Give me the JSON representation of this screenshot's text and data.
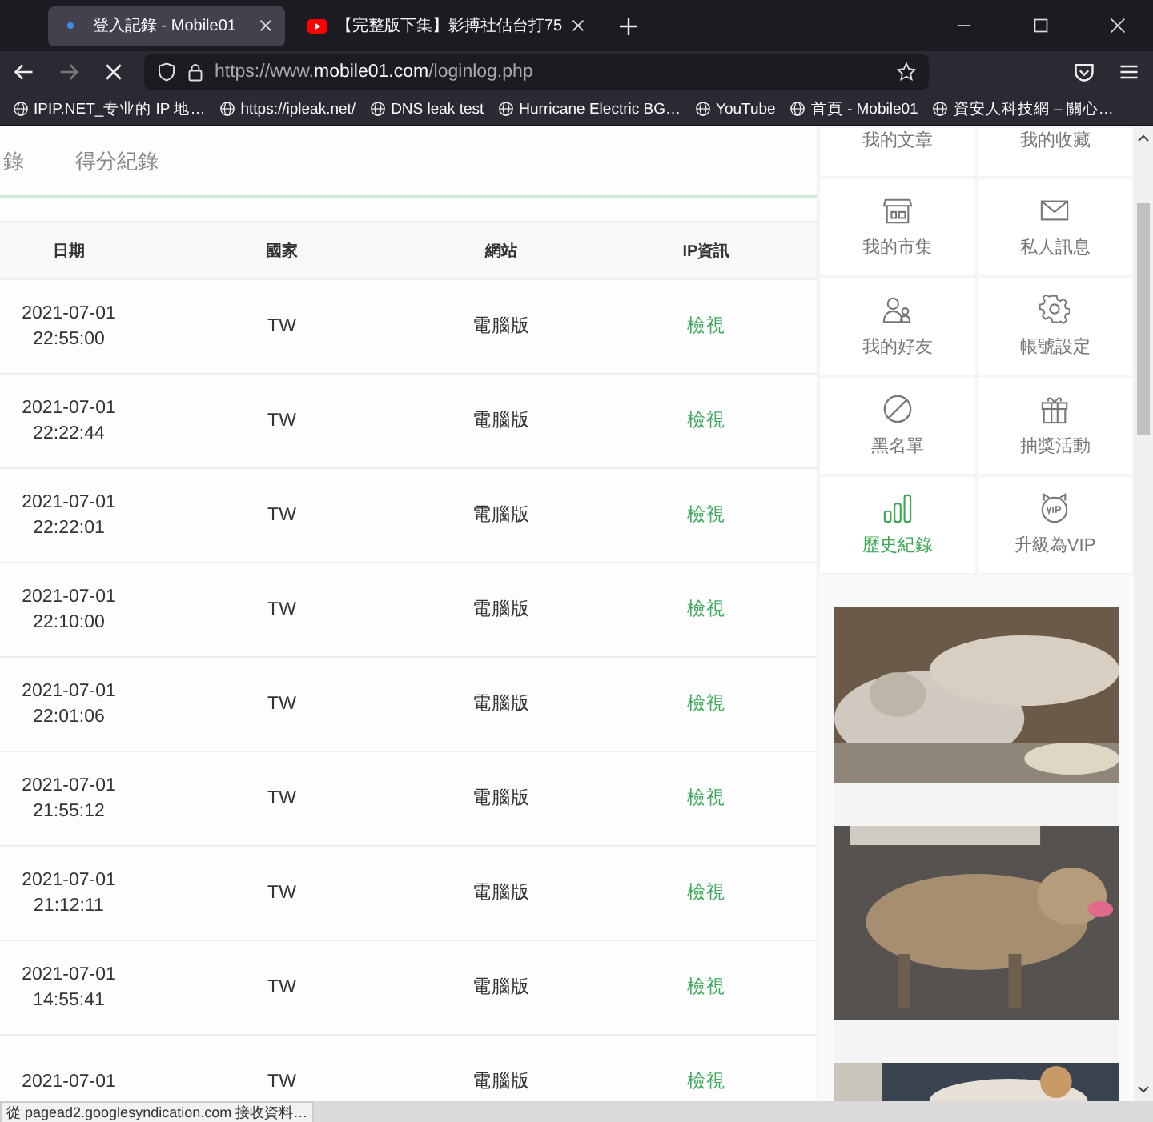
{
  "browser_tabs": [
    {
      "title": "登入記錄 - Mobile01",
      "selected": true
    },
    {
      "title": "【完整版下集】影搏社估台打75",
      "selected": false
    }
  ],
  "address_bar": {
    "prefix": "https://www.",
    "domain": "mobile01.com",
    "path": "/loginlog.php"
  },
  "bookmarks": [
    "IPIP.NET_专业的 IP 地…",
    "https://ipleak.net/",
    "DNS leak test",
    "Hurricane Electric BG…",
    "YouTube",
    "首頁 - Mobile01",
    "資安人科技網 – 關心…"
  ],
  "page_tabs": [
    "錄",
    "得分紀錄"
  ],
  "table": {
    "columns": [
      "日期",
      "國家",
      "網站",
      "IP資訊"
    ],
    "rows": [
      {
        "date": "2021-07-01",
        "time": "22:55:00",
        "country": "TW",
        "site": "電腦版",
        "ip": "檢視"
      },
      {
        "date": "2021-07-01",
        "time": "22:22:44",
        "country": "TW",
        "site": "電腦版",
        "ip": "檢視"
      },
      {
        "date": "2021-07-01",
        "time": "22:22:01",
        "country": "TW",
        "site": "電腦版",
        "ip": "檢視"
      },
      {
        "date": "2021-07-01",
        "time": "22:10:00",
        "country": "TW",
        "site": "電腦版",
        "ip": "檢視"
      },
      {
        "date": "2021-07-01",
        "time": "22:01:06",
        "country": "TW",
        "site": "電腦版",
        "ip": "檢視"
      },
      {
        "date": "2021-07-01",
        "time": "21:55:12",
        "country": "TW",
        "site": "電腦版",
        "ip": "檢視"
      },
      {
        "date": "2021-07-01",
        "time": "21:12:11",
        "country": "TW",
        "site": "電腦版",
        "ip": "檢視"
      },
      {
        "date": "2021-07-01",
        "time": "14:55:41",
        "country": "TW",
        "site": "電腦版",
        "ip": "檢視"
      },
      {
        "date": "2021-07-01",
        "country": "TW",
        "site": "電腦版",
        "ip": "檢視"
      }
    ]
  },
  "sidebar": {
    "items": [
      {
        "label": "我的文章",
        "selected": false
      },
      {
        "label": "我的收藏",
        "selected": false
      },
      {
        "label": "我的市集",
        "selected": false
      },
      {
        "label": "私人訊息",
        "selected": false
      },
      {
        "label": "我的好友",
        "selected": false
      },
      {
        "label": "帳號設定",
        "selected": false
      },
      {
        "label": "黑名單",
        "selected": false
      },
      {
        "label": "抽獎活動",
        "selected": false
      },
      {
        "label": "歷史紀錄",
        "selected": true
      },
      {
        "label": "升級為VIP",
        "selected": false
      }
    ]
  },
  "status_bar": "從 pagead2.googlesyndication.com 接收資料…"
}
